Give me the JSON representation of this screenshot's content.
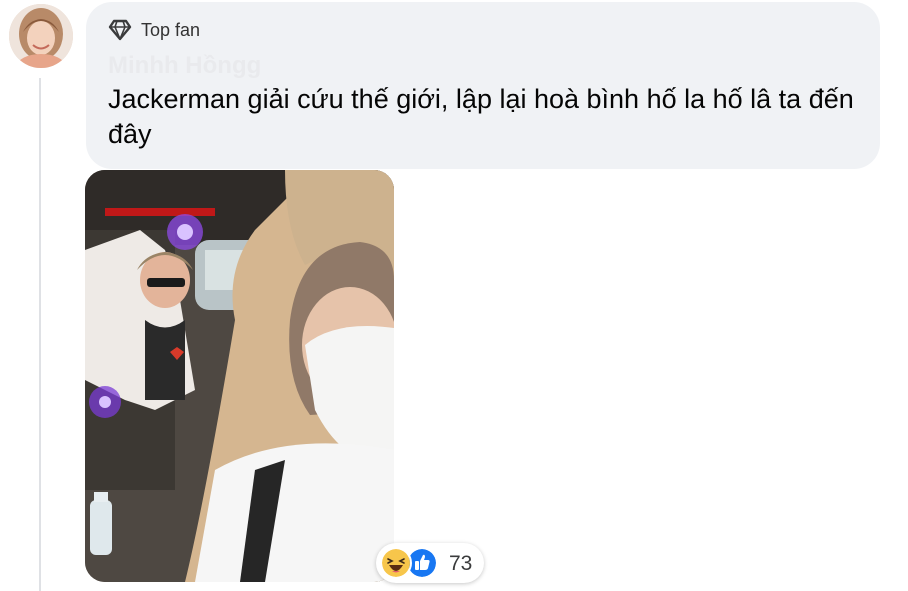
{
  "comment": {
    "badge_label": "Top fan",
    "badge_icon": "diamond-icon",
    "author_name": "Minhh Hồngg",
    "text": "Jackerman giải cứu thế giới, lập lại hoà bình hố la hố lâ ta đến đây",
    "attachment": "photo",
    "reaction_icons": [
      "haha-icon",
      "like-icon"
    ],
    "reaction_count": "73"
  },
  "colors": {
    "bubble_bg": "#f0f2f5",
    "text": "#050505",
    "like_blue": "#1877f2",
    "haha_yellow": "#f7c64b"
  }
}
